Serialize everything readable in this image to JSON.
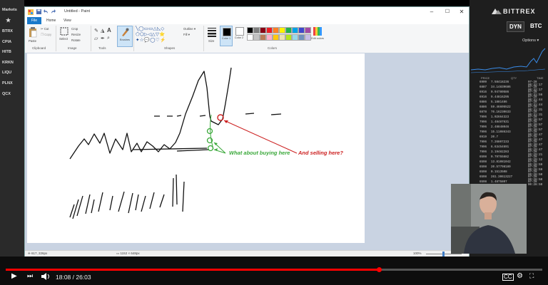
{
  "sidebar": {
    "items": [
      "Markets",
      "★",
      "BTRX",
      "CPIA",
      "HITB",
      "KRKN",
      "LIQU",
      "PLNX",
      "QCX"
    ]
  },
  "exchange": {
    "logo": "BITTREX",
    "pair_base": "DYN",
    "pair_quote": "BTC",
    "options_label": "Options ▾",
    "trades_header": [
      "PRICE",
      "QTY",
      "TIME"
    ],
    "trades": [
      {
        "price": "6909",
        "qty": "7.58418236",
        "time": "07-28 00:32:17"
      },
      {
        "price": "6887",
        "qty": "34.14839686",
        "time": "07-28 00:32:17"
      },
      {
        "price": "6916",
        "qty": "0.94780586",
        "time": "07-28 00:31:56"
      },
      {
        "price": "6916",
        "qty": "9.44816295",
        "time": "07-28 00:31:44"
      },
      {
        "price": "6886",
        "qty": "5.1881486",
        "time": "07-28 00:31:44"
      },
      {
        "price": "6886",
        "qty": "59.46605522",
        "time": "07-28 00:31:31"
      },
      {
        "price": "6878",
        "qty": "76.16230633",
        "time": "07-28 00:31:31"
      },
      {
        "price": "7996",
        "qty": "1.02664323",
        "time": "07-28 00:30:57"
      },
      {
        "price": "7996",
        "qty": "1.48487631",
        "time": "07-28 00:30:57"
      },
      {
        "price": "7996",
        "qty": "2.48848046",
        "time": "07-28 00:30:57"
      },
      {
        "price": "7996",
        "qty": "15.11086343",
        "time": "07-28 00:30:47"
      },
      {
        "price": "6919",
        "qty": "20.7",
        "time": "07-28 00:30:47"
      },
      {
        "price": "7996",
        "qty": "7.26807233",
        "time": "07-28 00:30:47"
      },
      {
        "price": "7996",
        "qty": "6.63454691",
        "time": "07-28 00:29:47"
      },
      {
        "price": "7996",
        "qty": "3.19482283",
        "time": "07-28 00:29:21"
      },
      {
        "price": "6598",
        "qty": "0.79755682",
        "time": "07-28 00:29:12"
      },
      {
        "price": "6598",
        "qty": "13.81081042",
        "time": "07-28 00:28:59"
      },
      {
        "price": "6598",
        "qty": "20.57798189",
        "time": "07-28 00:28:59"
      },
      {
        "price": "6598",
        "qty": "0.1513508",
        "time": "07-28 00:28:50"
      },
      {
        "price": "6598",
        "qty": "261.30613227",
        "time": "07-28 00:28:50"
      },
      {
        "price": "6598",
        "qty": "1.4875807",
        "time": "07-28 00:28:50"
      }
    ]
  },
  "paint": {
    "title": "Untitled - Paint",
    "menu": {
      "file": "File",
      "home": "Home",
      "view": "View"
    },
    "ribbon": {
      "paste": "Paste",
      "cut": "Cut",
      "copy": "Copy",
      "crop": "Crop",
      "resize": "Resize",
      "rotate": "Rotate",
      "select": "Select",
      "brushes": "Brushes",
      "outline": "Outline",
      "fill": "Fill",
      "size": "Size",
      "color1": "Color 1",
      "color2": "Color 2",
      "edit_colors": "Edit colors",
      "group_clipboard": "Clipboard",
      "group_image": "Image",
      "group_tools": "Tools",
      "group_shapes": "Shapes",
      "group_colors": "Colors"
    },
    "palette": [
      "#000000",
      "#7f7f7f",
      "#880015",
      "#ed1c24",
      "#ff7f27",
      "#fff200",
      "#22b14c",
      "#00a2e8",
      "#3f48cc",
      "#a349a4",
      "#ffffff",
      "#c3c3c3",
      "#b97a57",
      "#ffaec9",
      "#ffc90e",
      "#efe4b0",
      "#b5e61d",
      "#99d9ea",
      "#7092be",
      "#c8bfe7"
    ],
    "annotations": {
      "buy_text": "What about buying here",
      "sell_text": "And selling here?",
      "buy_color": "#3aa83a",
      "sell_color": "#cc1f1f"
    },
    "status": {
      "cursor": "617, 226px",
      "canvas_size": "1152 × 648px",
      "zoom": "100%"
    }
  },
  "video": {
    "time": "18:08 / 26:03",
    "progress": 0.696
  }
}
